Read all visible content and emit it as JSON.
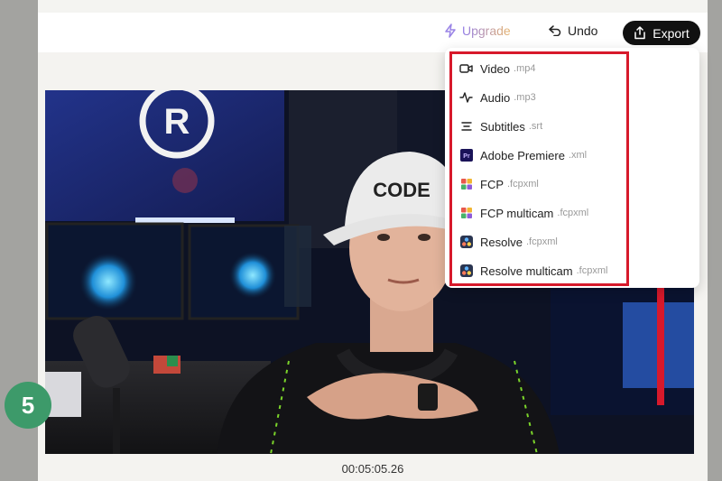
{
  "topbar": {
    "upgrade_label": "Upgrade",
    "undo_label": "Undo",
    "export_label": "Export"
  },
  "export_menu": {
    "items": [
      {
        "label": "Video",
        "ext": ".mp4",
        "icon": "video-icon"
      },
      {
        "label": "Audio",
        "ext": ".mp3",
        "icon": "audio-waveform-icon"
      },
      {
        "label": "Subtitles",
        "ext": ".srt",
        "icon": "subtitles-icon"
      },
      {
        "label": "Adobe Premiere",
        "ext": ".xml",
        "icon": "premiere-icon"
      },
      {
        "label": "FCP",
        "ext": ".fcpxml",
        "icon": "fcp-icon"
      },
      {
        "label": "FCP multicam",
        "ext": ".fcpxml",
        "icon": "fcp-icon"
      },
      {
        "label": "Resolve",
        "ext": ".fcpxml",
        "icon": "resolve-icon"
      },
      {
        "label": "Resolve multicam",
        "ext": ".fcpxml",
        "icon": "resolve-icon"
      }
    ]
  },
  "player": {
    "timecode": "00:05:05.26",
    "cap_text": "CODE"
  },
  "step_badge": "5",
  "colors": {
    "highlight": "#d7192b",
    "badge": "#3d9a6a",
    "export_bg": "#111111"
  }
}
